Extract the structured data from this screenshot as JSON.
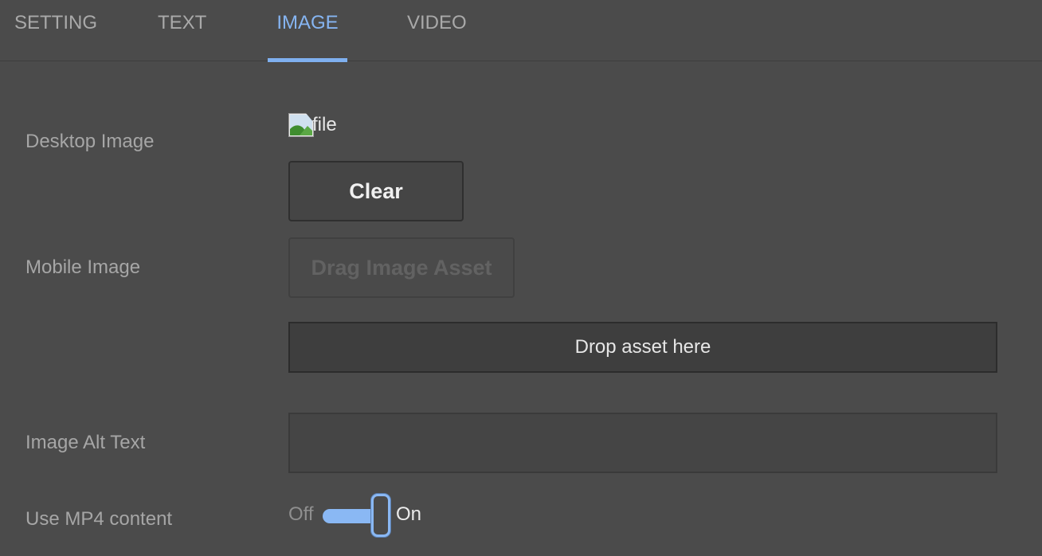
{
  "tabs": [
    {
      "label": "SETTING",
      "active": false
    },
    {
      "label": "TEXT",
      "active": false
    },
    {
      "label": "IMAGE",
      "active": true
    },
    {
      "label": "VIDEO",
      "active": false
    }
  ],
  "accent_color": "#7fb0f0",
  "desktop_image": {
    "label": "Desktop Image",
    "thumbnail_alt": "file",
    "thumbnail_icon": "broken-image-icon",
    "clear_button": "Clear"
  },
  "mobile_image": {
    "label": "Mobile Image",
    "drag_button": "Drag Image Asset",
    "dropzone_text": "Drop asset here"
  },
  "alt_text": {
    "label": "Image Alt Text",
    "value": "",
    "placeholder": ""
  },
  "mp4": {
    "label": "Use MP4 content",
    "off_label": "Off",
    "on_label": "On",
    "state": "on"
  }
}
